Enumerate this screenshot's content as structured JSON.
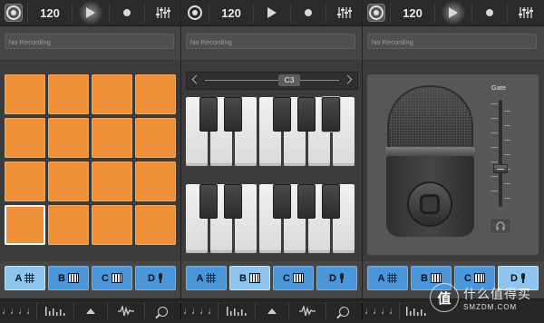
{
  "topbar": {
    "bpm": "120"
  },
  "recording": {
    "status": "No Recording"
  },
  "keyboard": {
    "octave": "C3"
  },
  "mic": {
    "gate_label": "Gate"
  },
  "tracks": [
    {
      "letter": "A",
      "icon": "grid-icon"
    },
    {
      "letter": "B",
      "icon": "piano-icon"
    },
    {
      "letter": "C",
      "icon": "piano-icon"
    },
    {
      "letter": "D",
      "icon": "mic-icon"
    }
  ],
  "selected_tracks": {
    "drums": "A",
    "keys": "B",
    "mic": "D"
  },
  "bottombar": {
    "loops_icon": "♩♩♩♩",
    "items": [
      "loops-icon",
      "transport-icon",
      "up-arrow-icon",
      "waveform-icon",
      "search-icon"
    ]
  },
  "watermark": {
    "logo_text": "值",
    "cn": "什么值得买",
    "en": "SMZDM.COM"
  },
  "colors": {
    "pad": "#f0913a",
    "track": "#4a96d8",
    "track_selected": "#8ec5ef"
  }
}
